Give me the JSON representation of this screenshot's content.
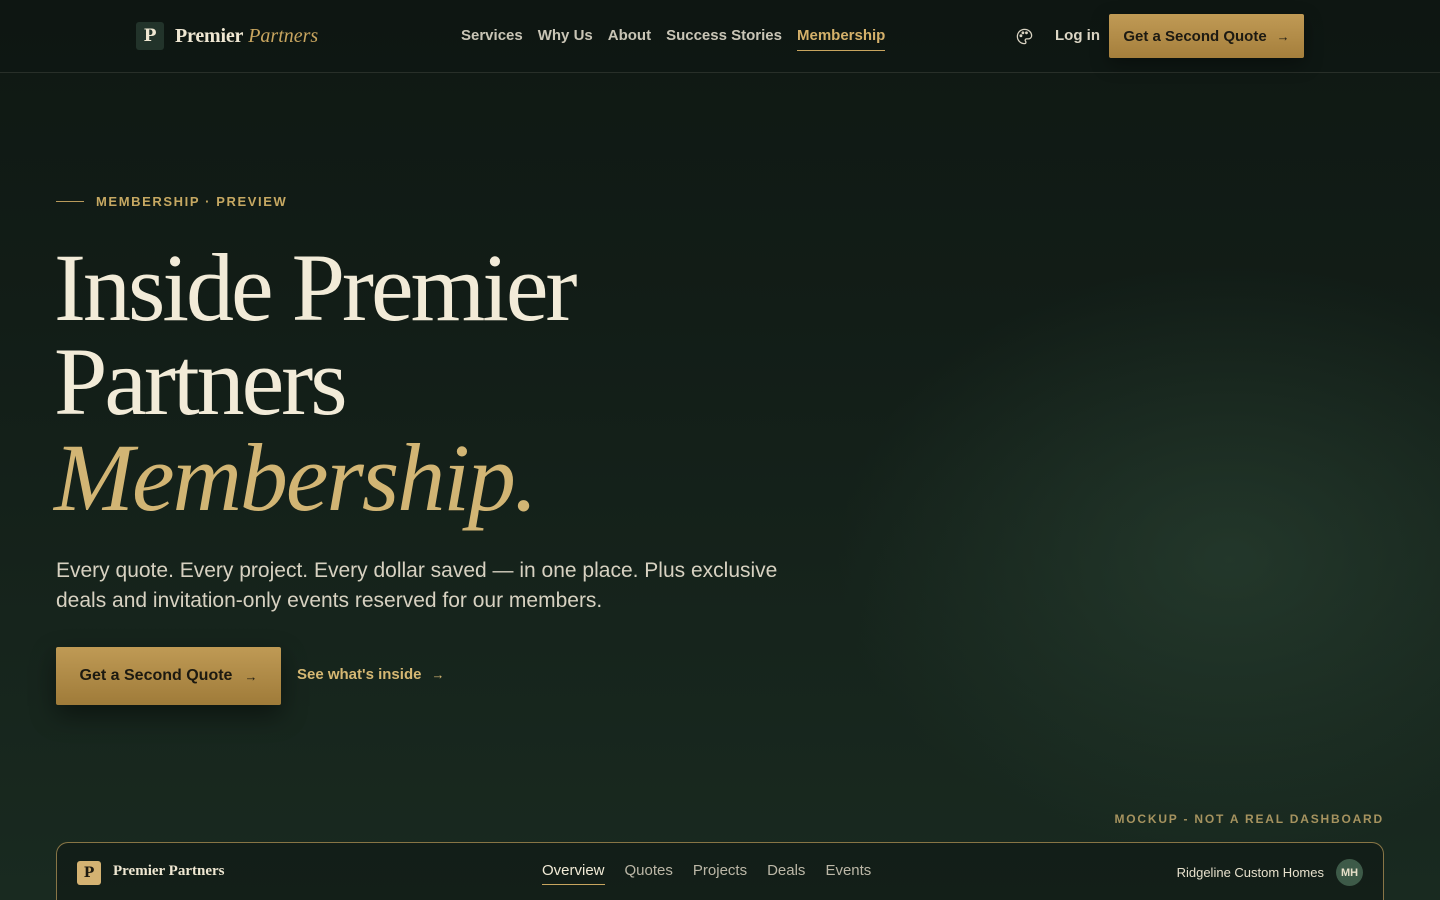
{
  "header": {
    "logo_letter": "P",
    "brand_name": "Premier",
    "brand_accent": "Partners",
    "nav": [
      {
        "label": "Services"
      },
      {
        "label": "Why Us"
      },
      {
        "label": "About"
      },
      {
        "label": "Success Stories"
      },
      {
        "label": "Membership"
      }
    ],
    "active_nav": "Membership",
    "login_label": "Log in",
    "cta_label": "Get a Second Quote",
    "icons": {
      "theme": "palette-icon",
      "arrow": "arrow-right-icon"
    }
  },
  "hero": {
    "eyebrow": "MEMBERSHIP · PREVIEW",
    "title_line1": "Inside Premier",
    "title_line2": "Partners",
    "title_line3": "Membership.",
    "lede": "Every quote. Every project. Every dollar saved — in one place. Plus exclusive deals and invitation-only events reserved for our members.",
    "primary_cta": "Get a Second Quote",
    "secondary_cta": "See what's inside"
  },
  "mockup": {
    "note": "MOCKUP - NOT A REAL DASHBOARD",
    "logo_letter": "P",
    "brand": "Premier Partners",
    "tabs": [
      {
        "label": "Overview"
      },
      {
        "label": "Quotes"
      },
      {
        "label": "Projects"
      },
      {
        "label": "Deals"
      },
      {
        "label": "Events"
      }
    ],
    "active_tab": "Overview",
    "user_name": "Ridgeline Custom Homes",
    "user_initials": "MH"
  },
  "colors": {
    "background": "#101a15",
    "gold": "#c8a55f",
    "cream": "#f2ebd8"
  }
}
